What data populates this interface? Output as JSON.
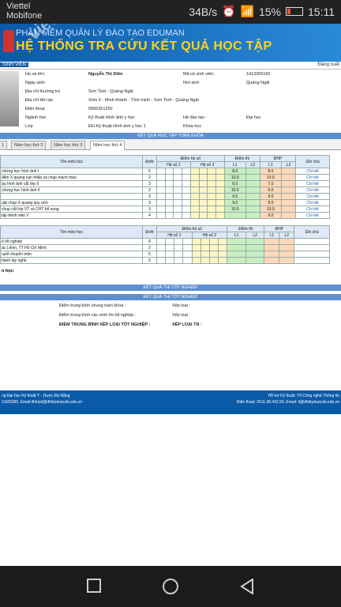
{
  "status": {
    "carrier1": "Viettel",
    "carrier2": "Mobifone",
    "speed": "34B/s",
    "battery": "15%",
    "time": "15:11"
  },
  "banner": {
    "subtitle": "PHẦN MỀM QUẢN LÝ ĐÀO TẠO EDUMAN",
    "title": "HỆ THỐNG TRA CỨU KẾT QUẢ HỌC TẬP",
    "watermark": "vietnamnet"
  },
  "tabline": {
    "left": "SINH VIÊN",
    "right": "Đăng xuất"
  },
  "student": {
    "name_label": "Họ và tên:",
    "name": "Nguyễn Thị Diên",
    "id_label": "Mã số sinh viên:",
    "id": "1413300160",
    "dob_label": "Ngày sinh:",
    "pob_label": "Nơi sinh",
    "pob": "Quảng Ngãi",
    "addr_label": "Địa chỉ thường trú",
    "addr": "Sơn Tịnh - Quảng Ngãi",
    "contact_label": "Địa chỉ liên lạc",
    "contact": "Xóm 6 - Minh khánh - Tỉnh minh - Sơn Tịnh - Quảng Ngãi",
    "phone_label": "Điện thoại",
    "phone": "0966351250",
    "major_label": "Ngành học",
    "major": "Kỹ thuật Hình ảnh y học",
    "type_label": "Hệ đào tạo :",
    "type": "Đại học",
    "class_label": "Lớp",
    "class": "ĐH Kỹ thuật Hình ảnh y học 1",
    "course_label": "Khóa học"
  },
  "results_title": "KẾT QUẢ HỌC TẬP TOÀN KHÓA",
  "year_tabs": [
    "1",
    "Năm học thứ 2",
    "Năm học thứ 3",
    "Năm học thứ 4"
  ],
  "table_headers": {
    "subject": "Tên môn học",
    "credits": "Đvht",
    "scores": "Điểm hệ số",
    "coef1": "Hệ số 1",
    "coef2": "Hệ số 2",
    "exam": "Điểm thi",
    "dhp": "ĐHP",
    "l1": "L1",
    "l2": "L2",
    "note": "Ghi chú"
  },
  "rows": [
    {
      "subject": "chứng học hình ảnh I",
      "credits": "5",
      "exam_l1": "8.0",
      "dhp_l1": "8.0",
      "note": "Chi tiết"
    },
    {
      "subject": "điện X quang can thiệp và chụp mạch máu",
      "credits": "2",
      "exam_l1": "10.0",
      "dhp_l1": "10.0",
      "note": "Chi tiết"
    },
    {
      "subject": "ầu hình ảnh cắt lớp II",
      "credits": "3",
      "exam_l1": "6.0",
      "dhp_l1": "7.0",
      "note": "Chi tiết"
    },
    {
      "subject": "chứng học hình ảnh II",
      "credits": "2",
      "exam_l1": "10.0",
      "dhp_l1": "9.0",
      "note": "Chi tiết"
    },
    {
      "subject": "",
      "credits": "3",
      "exam_l1": "9.0",
      "dhp_l1": "9.0",
      "note": "Chi tiết"
    },
    {
      "subject": "uật chụp X quang quy ước",
      "credits": "3",
      "exam_l1": "9.0",
      "dhp_l1": "9.0",
      "note": "Chi tiết"
    },
    {
      "subject": "chụp cắt lớp VT và CHT bổ sung",
      "credits": "3",
      "exam_l1": "10.0",
      "dhp_l1": "10.0",
      "note": "Chi tiết"
    },
    {
      "subject": "tập bệnh viện V",
      "credits": "4",
      "exam_l1": "",
      "dhp_l1": "9.0",
      "note": "Chi tiết"
    }
  ],
  "rows2": [
    {
      "subject": "ế tốt nghiệp",
      "credits": "6"
    },
    {
      "subject": "ác Lênin, TT Hồ Chí Minh",
      "credits": "2"
    },
    {
      "subject": "uyết chuyên môn",
      "credits": "5"
    },
    {
      "subject": "hành tay nghề",
      "credits": "5"
    }
  ],
  "note_label": "n học:",
  "grad_title": "KẾT QUẢ THI TỐT NGHIỆP",
  "grad": {
    "l1": "Điểm trung bình chung toàn khóa :",
    "r1": "Xếp loại :",
    "l2": "Điểm trung bình các môn thi tốt nghiệp :",
    "r2": "Xếp loại :",
    "l3": "ĐIỂM TRUNG BÌNH XẾP LOẠI TỐT NGHIỆP :",
    "r3": "XẾP LOẠI TN :"
  },
  "footer": {
    "left1": "ng Đại học Kỹ thuật Y - Dược Đà Nẵng",
    "left2": "3.825380. Email:dhktyd@dhktyduocdn.edu.vn",
    "right1": "Hỗ trợ Kỹ thuật: Tổ Công nghệ Thông tin",
    "right2": "Điện thoại: 0511.38.432.56. Email: it@dhktyduocdn.edu.vn"
  }
}
